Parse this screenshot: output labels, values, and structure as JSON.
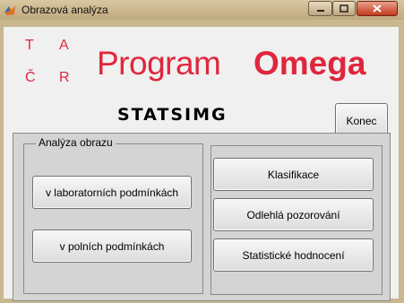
{
  "window": {
    "title": "Obrazová analýza"
  },
  "logo": {
    "letters": [
      "T",
      "A",
      "Č",
      "R"
    ],
    "program": "Program",
    "omega": "Omega",
    "subtitle": "STATSIMG"
  },
  "buttons": {
    "konec": "Konec",
    "lab": "v laboratorních podmínkách",
    "field": "v polních podmínkách",
    "klasifikace": "Klasifikace",
    "odlehla": "Odlehlá pozorování",
    "statisticke": "Statistické hodnocení"
  },
  "group": {
    "label": "Analýza obrazu"
  },
  "colors": {
    "brand_red": "#e0263c",
    "client_bg": "#f0f0f0",
    "panel_bg": "#d4d4d4"
  }
}
